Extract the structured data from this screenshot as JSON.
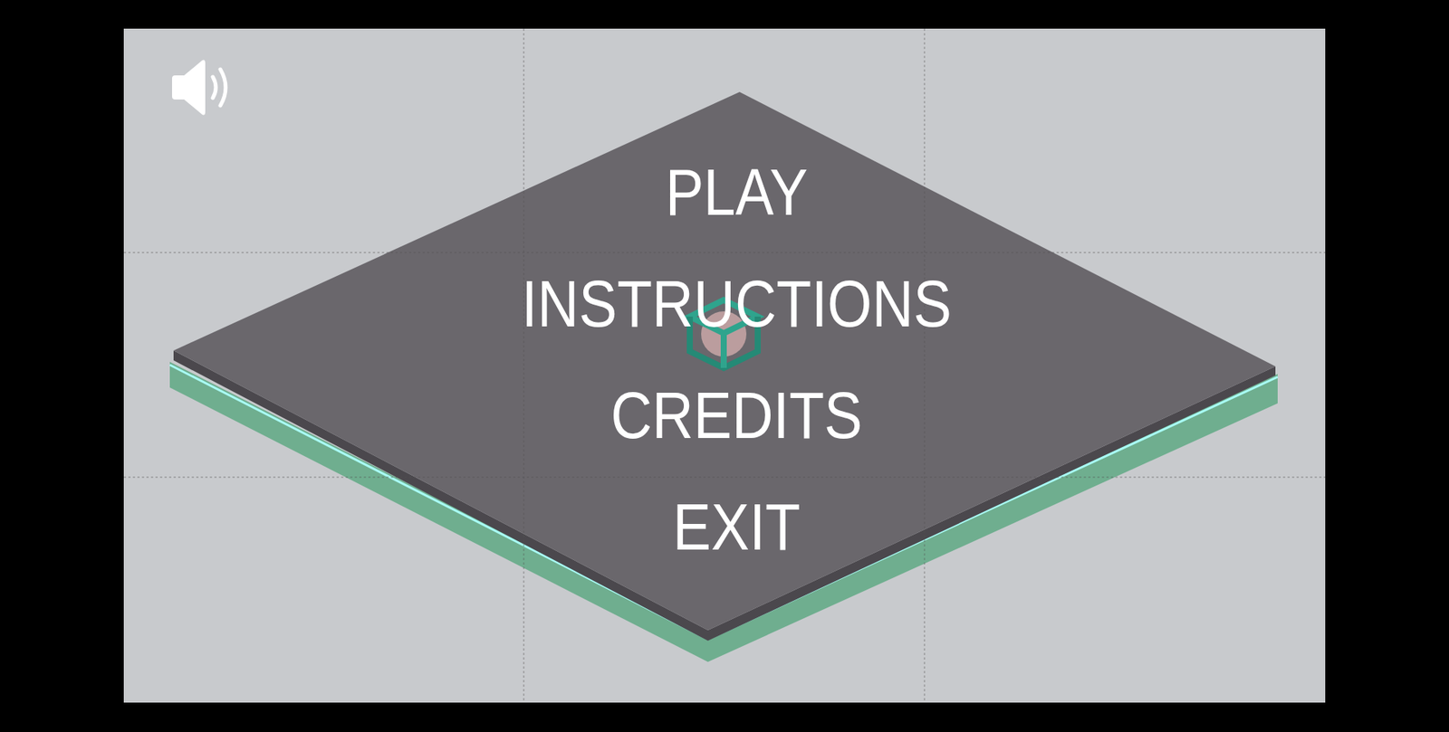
{
  "sound": {
    "muted": false
  },
  "menu": {
    "items": [
      {
        "label": "PLAY"
      },
      {
        "label": "INSTRUCTIONS"
      },
      {
        "label": "CREDITS"
      },
      {
        "label": "EXIT"
      }
    ]
  }
}
